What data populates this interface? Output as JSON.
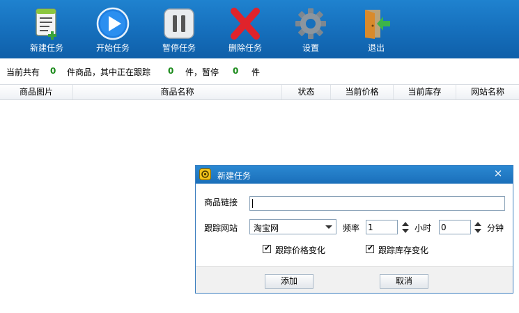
{
  "toolbar": {
    "buttons": [
      {
        "label": "新建任务",
        "icon": "new-task-icon"
      },
      {
        "label": "开始任务",
        "icon": "play-icon"
      },
      {
        "label": "暂停任务",
        "icon": "pause-icon"
      },
      {
        "label": "删除任务",
        "icon": "delete-icon"
      },
      {
        "label": "设置",
        "icon": "gear-icon"
      },
      {
        "label": "退出",
        "icon": "exit-door-icon"
      }
    ],
    "colors": {
      "background": "#1670bd",
      "label": "#ffffff"
    }
  },
  "summary": {
    "prefix": "当前共有",
    "total": "0",
    "mid": "件商品，其中正在跟踪",
    "tracking": "0",
    "mid2": "件，暂停",
    "paused": "0",
    "suffix": "件",
    "count_color": "#1b8a1b"
  },
  "table": {
    "columns": [
      "商品图片",
      "商品名称",
      "状态",
      "当前价格",
      "当前库存",
      "网站名称"
    ],
    "rows": []
  },
  "dialog": {
    "title": "新建任务",
    "close": "×",
    "url_label": "商品链接",
    "url_value": "",
    "site_label": "跟踪网站",
    "site_value": "淘宝网",
    "freq_label": "频率",
    "hours_value": "1",
    "hours_unit": "小时",
    "minutes_value": "0",
    "minutes_unit": "分钟",
    "track_price_label": "跟踪价格变化",
    "track_price_checked": true,
    "track_stock_label": "跟踪库存变化",
    "track_stock_checked": true,
    "add_label": "添加",
    "cancel_label": "取消"
  }
}
